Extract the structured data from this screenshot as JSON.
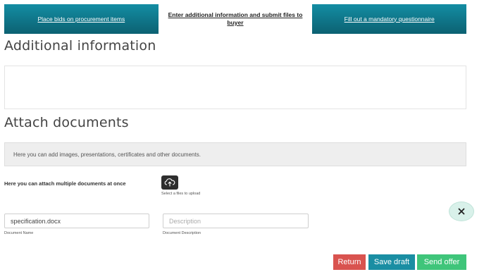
{
  "tabs": [
    {
      "label": "Place bids on procurement items",
      "active": false
    },
    {
      "label": "Enter additional information and submit files to buyer",
      "active": true
    },
    {
      "label": "Fill out a mandatory questionnaire",
      "active": false
    }
  ],
  "additional": {
    "heading": "Additional information",
    "value": ""
  },
  "attach": {
    "heading": "Attach documents",
    "info_text": "Here you can add images, presentations, certificates and other documents.",
    "multi_label": "Here you can attach multiple documents at once",
    "upload_icon": "cloud-upload-icon",
    "upload_caption": "Select a files to upload"
  },
  "document": {
    "name_value": "specification.docx",
    "name_caption": "Document Name",
    "description_value": "",
    "description_placeholder": "Description",
    "description_caption": "Document Description",
    "remove_icon": "close-icon"
  },
  "actions": {
    "return_label": "Return",
    "save_draft_label": "Save draft",
    "send_offer_label": "Send offer"
  },
  "colors": {
    "tab_bg": "#0f7688",
    "return": "#d9534f",
    "save_draft": "#1a8ea3",
    "send_offer": "#3fc57a"
  }
}
